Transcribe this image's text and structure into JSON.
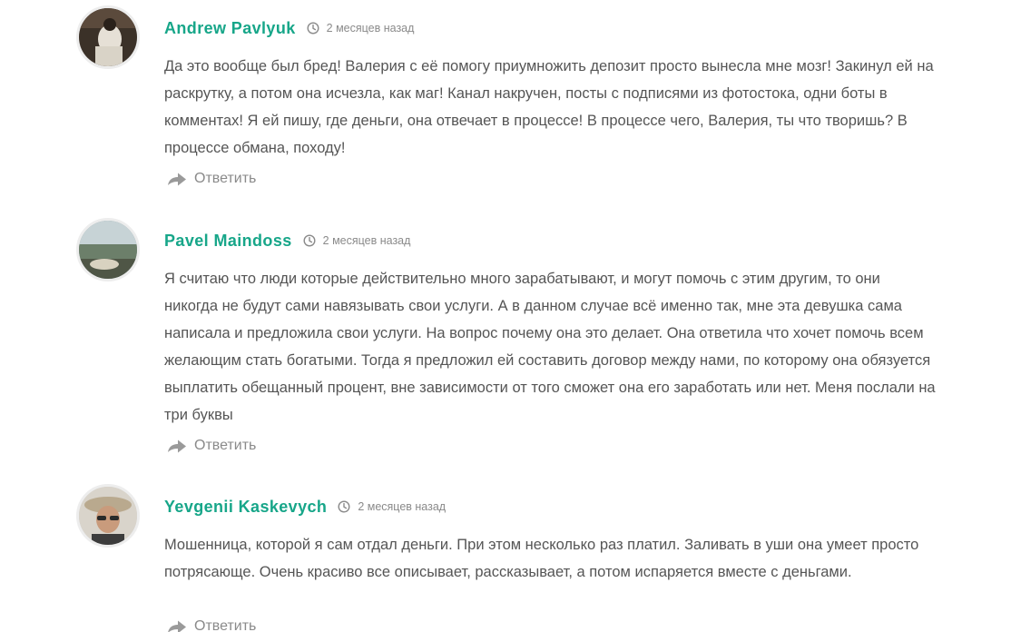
{
  "colors": {
    "author": "#17a689",
    "text": "#555555",
    "meta": "#8a8a8a"
  },
  "comments": [
    {
      "author": "Andrew Pavlyuk",
      "time": "2 месяцев назад",
      "text": "Да это вообще был бред! Валерия с её помогу приумножить депозит просто вынесла мне мозг! Закинул ей на раскрутку, а потом она исчезла, как маг! Канал накручен, посты с подписями из фотостока, одни боты в комментах! Я ей пишу, где деньги, она отвечает в процессе! В процессе чего, Валерия, ты что творишь? В процессе обмана, походу!",
      "reply_label": "Ответить",
      "icons": {
        "clock": "clock-icon",
        "reply": "reply-arrow-icon"
      }
    },
    {
      "author": "Pavel Maindoss",
      "time": "2 месяцев назад",
      "text": "Я считаю что люди которые действительно много зарабатывают, и могут помочь с этим другим, то они никогда не будут сами навязывать свои услуги. А в данном случае всё именно так, мне эта девушка сама написала и предложила свои услуги. На вопрос почему она это делает. Она ответила что хочет помочь всем желающим стать богатыми. Тогда я предложил ей составить договор между нами, по которому она обязуется выплатить обещанный процент, вне зависимости от того сможет она его заработать или нет. Меня послали на три буквы",
      "reply_label": "Ответить",
      "icons": {
        "clock": "clock-icon",
        "reply": "reply-arrow-icon"
      }
    },
    {
      "author": "Yevgenii Kaskevych",
      "time": "2 месяцев назад",
      "text": "Мошенница, которой я сам отдал деньги. При этом несколько раз платил. Заливать в уши она умеет просто потрясающе. Очень красиво все описывает, рассказывает, а потом испаряется вместе с деньгами.",
      "reply_label": "Ответить",
      "icons": {
        "clock": "clock-icon",
        "reply": "reply-arrow-icon"
      }
    }
  ]
}
